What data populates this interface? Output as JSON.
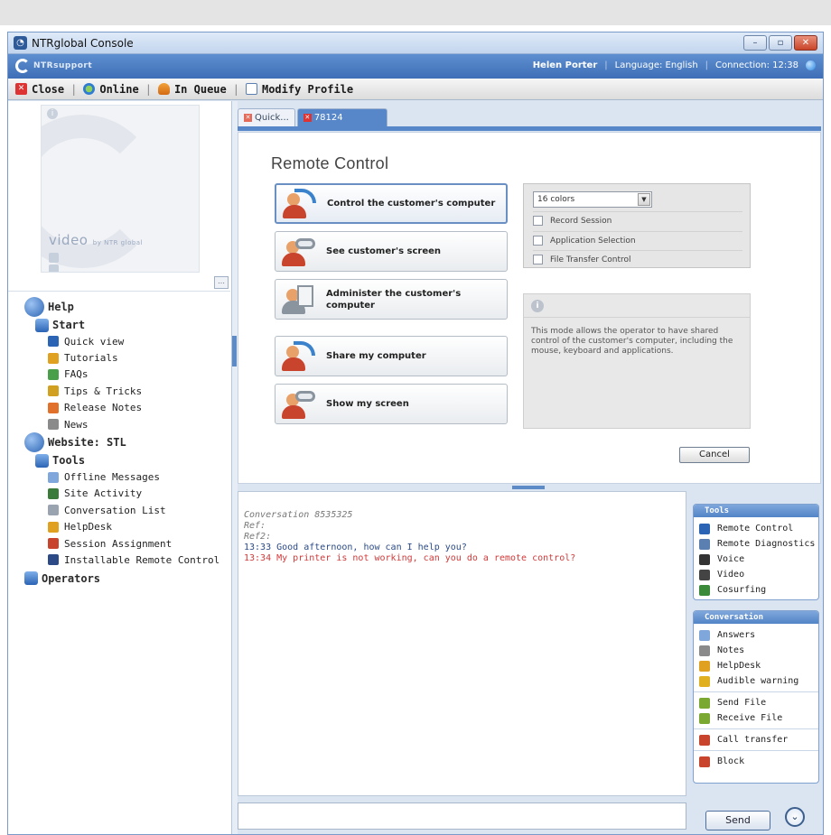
{
  "window": {
    "title": "NTRglobal Console"
  },
  "brand": {
    "logo_text": "NTRsupport",
    "user": "Helen Porter",
    "language": "Language: English",
    "connection": "Connection: 12:38"
  },
  "toolbar": {
    "close_label": "Close",
    "online_label": "Online",
    "queue_label": "In Queue",
    "profile_label": "Modify Profile"
  },
  "left": {
    "video_label": "video",
    "video_by": "by NTR global",
    "help_label": "Help",
    "start_label": "Start",
    "start_items": [
      {
        "label": "Quick view",
        "icon": "quick-view-icon",
        "color": "#2b64b4"
      },
      {
        "label": "Tutorials",
        "icon": "tutorials-icon",
        "color": "#e0a020"
      },
      {
        "label": "FAQs",
        "icon": "faqs-icon",
        "color": "#4aa04a"
      },
      {
        "label": "Tips & Tricks",
        "icon": "tips-icon",
        "color": "#d2a020"
      },
      {
        "label": "Release Notes",
        "icon": "release-notes-icon",
        "color": "#e0702a"
      },
      {
        "label": "News",
        "icon": "news-icon",
        "color": "#8a8a8a"
      }
    ],
    "website_label": "Website: STL",
    "tools_label": "Tools",
    "tools_items": [
      {
        "label": "Offline Messages",
        "icon": "offline-messages-icon",
        "color": "#7fa7dc"
      },
      {
        "label": "Site Activity",
        "icon": "site-activity-icon",
        "color": "#3a7a3a"
      },
      {
        "label": "Conversation List",
        "icon": "conversation-list-icon",
        "color": "#9aa4b0"
      },
      {
        "label": "HelpDesk",
        "icon": "helpdesk-icon",
        "color": "#e0a020"
      },
      {
        "label": "Session Assignment",
        "icon": "session-assignment-icon",
        "color": "#c9442c"
      },
      {
        "label": "Installable Remote Control",
        "icon": "installable-rc-icon",
        "color": "#2b4a86"
      }
    ],
    "operators_label": "Operators"
  },
  "tabs": [
    {
      "label": "Quick...",
      "active": false
    },
    {
      "label": "78124",
      "active": true
    }
  ],
  "remote": {
    "title": "Remote Control",
    "buttons": [
      {
        "label": "Control the customer's computer",
        "icon": "control-computer-icon"
      },
      {
        "label": "See customer's screen",
        "icon": "see-screen-icon"
      },
      {
        "label": "Administer the customer's computer",
        "icon": "administer-icon"
      },
      {
        "label": "Share my computer",
        "icon": "share-computer-icon"
      },
      {
        "label": "Show my screen",
        "icon": "show-screen-icon"
      }
    ],
    "colors_select": "16 colors",
    "checkboxes": [
      "Record Session",
      "Application Selection",
      "File Transfer Control"
    ],
    "description": "This mode allows the operator to have shared control of the customer's computer, including the mouse, keyboard and applications.",
    "cancel_label": "Cancel"
  },
  "chat": {
    "conversation": "Conversation  8535325",
    "ref": "Ref:",
    "ref2": "Ref2:",
    "messages": [
      {
        "time_text": "13:33 Good afternoon, how can I help you?",
        "from": "operator"
      },
      {
        "time_text": "13:34 My printer is not working, can you do a remote control?",
        "from": "customer"
      }
    ]
  },
  "tools_box": {
    "header": "Tools",
    "items": [
      {
        "label": "Remote Control",
        "icon": "remote-control-icon",
        "color": "#2b64b4"
      },
      {
        "label": "Remote Diagnostics",
        "icon": "remote-diagnostics-icon",
        "color": "#5a7fb0"
      },
      {
        "label": "Voice",
        "icon": "voice-icon",
        "color": "#333333"
      },
      {
        "label": "Video",
        "icon": "video-icon",
        "color": "#444444"
      },
      {
        "label": "Cosurfing",
        "icon": "cosurfing-icon",
        "color": "#3a8a3a"
      }
    ]
  },
  "conversation_box": {
    "header": "Conversation",
    "items": [
      {
        "label": "Answers",
        "icon": "answers-icon",
        "color": "#7fa7dc"
      },
      {
        "label": "Notes",
        "icon": "notes-icon",
        "color": "#8a8a8a"
      },
      {
        "label": "HelpDesk",
        "icon": "helpdesk-icon",
        "color": "#e0a020"
      },
      {
        "label": "Audible warning",
        "icon": "audible-warning-icon",
        "color": "#e0b020"
      },
      {
        "label": "Send File",
        "icon": "send-file-icon",
        "color": "#7aa830"
      },
      {
        "label": "Receive File",
        "icon": "receive-file-icon",
        "color": "#7aa830"
      },
      {
        "label": "Call transfer",
        "icon": "call-transfer-icon",
        "color": "#c9442c"
      },
      {
        "label": "Block",
        "icon": "block-icon",
        "color": "#c9442c"
      }
    ]
  },
  "send_label": "Send"
}
